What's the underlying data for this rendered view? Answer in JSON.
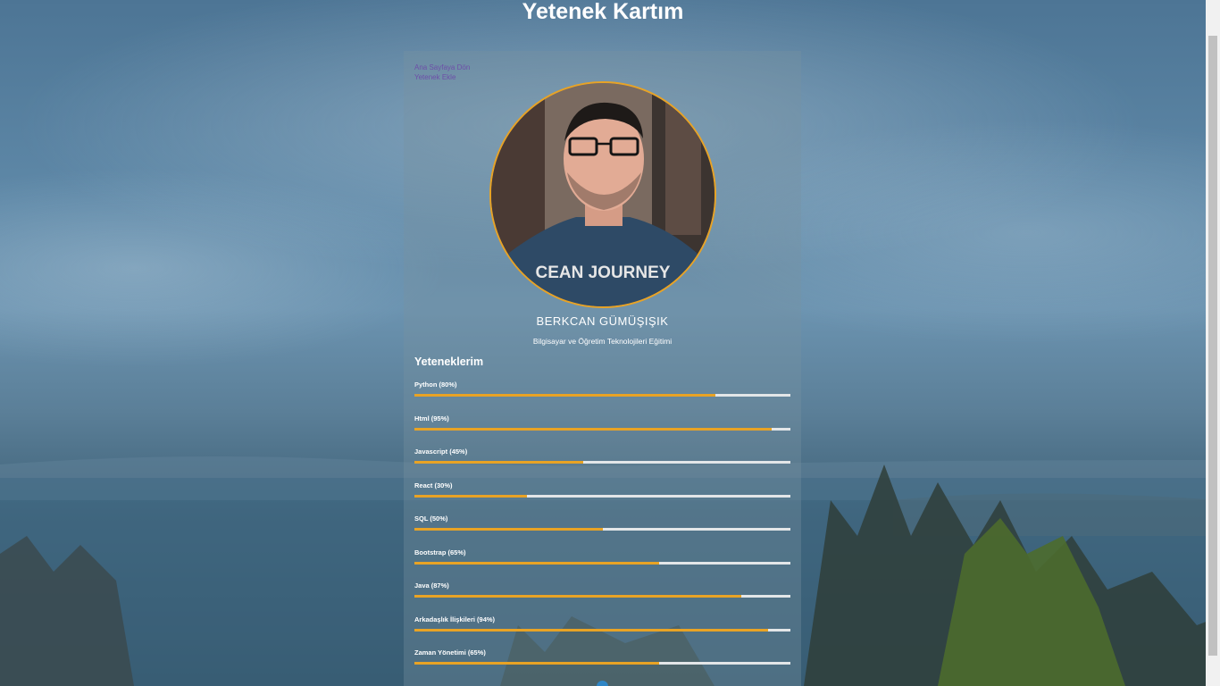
{
  "page": {
    "title": "Yetenek Kartım"
  },
  "nav": {
    "links": [
      {
        "label": "Ana Sayfaya Dön"
      },
      {
        "label": "Yetenek Ekle"
      }
    ]
  },
  "profile": {
    "name": "BERKCAN GÜMÜŞIŞIK",
    "subtitle": "Bilgisayar ve Öğretim Teknolojileri Eğitimi",
    "avatar_shirt_text": "CEAN JOURNEY"
  },
  "skills": {
    "heading": "Yeteneklerim",
    "items": [
      {
        "label": "Python (80%)",
        "percent": 80
      },
      {
        "label": "Html (95%)",
        "percent": 95
      },
      {
        "label": "Javascript (45%)",
        "percent": 45
      },
      {
        "label": "React (30%)",
        "percent": 30
      },
      {
        "label": "SQL (50%)",
        "percent": 50
      },
      {
        "label": "Bootstrap (65%)",
        "percent": 65
      },
      {
        "label": "Java (87%)",
        "percent": 87
      },
      {
        "label": "Arkadaşlık İlişkileri (94%)",
        "percent": 94
      },
      {
        "label": "Zaman Yönetimi (65%)",
        "percent": 65
      }
    ]
  },
  "colors": {
    "accent": "#e8a325",
    "track": "#e3e6e8",
    "link": "#6d4ea8",
    "social": "#2f86c6"
  },
  "icons": {
    "social": "linkedin-icon"
  }
}
